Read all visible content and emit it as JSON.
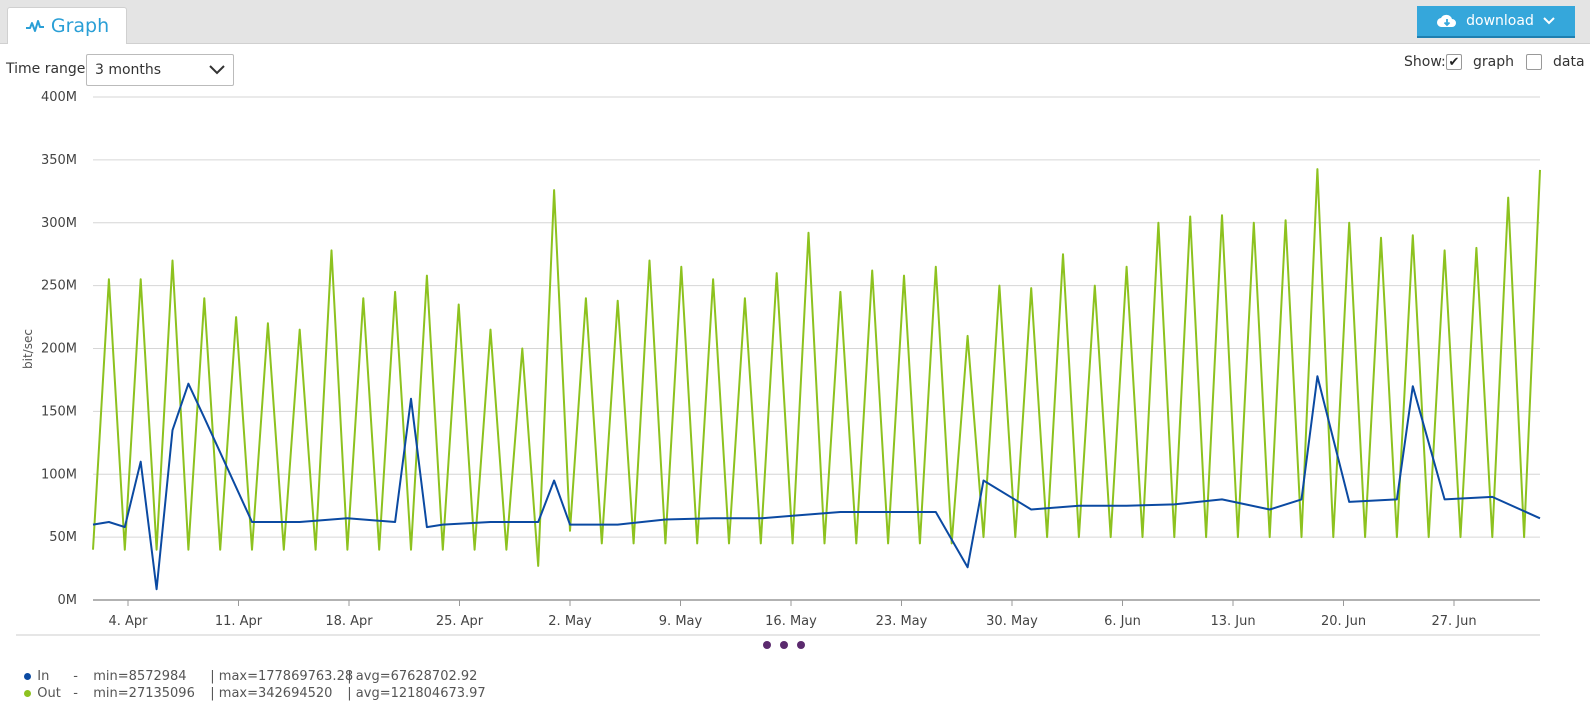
{
  "tab": {
    "label": "Graph",
    "icon": "activity-icon"
  },
  "download": {
    "label": "download",
    "icon": "cloud-download-icon"
  },
  "controls": {
    "time_range_label": "Time range:",
    "time_range_value": "3 months",
    "show_label": "Show:",
    "graph_label": "graph",
    "graph_checked": true,
    "data_label": "data",
    "data_checked": false
  },
  "legend": [
    {
      "name": "In",
      "dash": "-",
      "min": "min=8572984",
      "max": "| max=177869763.28",
      "avg": "| avg=67628702.92",
      "color": "#0b4aa2"
    },
    {
      "name": "Out",
      "dash": "-",
      "min": "min=27135096",
      "max": "| max=342694520",
      "avg": "| avg=121804673.97",
      "color": "#8dc21f"
    }
  ],
  "chart_data": {
    "type": "line",
    "ylabel": "bit/sec",
    "ylim": [
      0,
      400000000
    ],
    "yticks": [
      "0M",
      "50M",
      "100M",
      "150M",
      "200M",
      "250M",
      "300M",
      "350M",
      "400M"
    ],
    "xlim": [
      "2021-04-02",
      "2021-07-02"
    ],
    "xticks": [
      "4. Apr",
      "11. Apr",
      "18. Apr",
      "25. Apr",
      "2. May",
      "9. May",
      "16. May",
      "23. May",
      "30. May",
      "6. Jun",
      "13. Jun",
      "20. Jun",
      "27. Jun"
    ],
    "grid": true,
    "series": [
      {
        "name": "In",
        "color": "#0b4aa2",
        "x": [
          "2021-04-02",
          "2021-04-03",
          "2021-04-04",
          "2021-04-05",
          "2021-04-06",
          "2021-04-07",
          "2021-04-08",
          "2021-04-09",
          "2021-04-12",
          "2021-04-15",
          "2021-04-18",
          "2021-04-21",
          "2021-04-22",
          "2021-04-23",
          "2021-04-24",
          "2021-04-27",
          "2021-04-30",
          "2021-05-01",
          "2021-05-02",
          "2021-05-05",
          "2021-05-08",
          "2021-05-11",
          "2021-05-14",
          "2021-05-16",
          "2021-05-19",
          "2021-05-22",
          "2021-05-25",
          "2021-05-27",
          "2021-05-28",
          "2021-05-31",
          "2021-06-03",
          "2021-06-06",
          "2021-06-09",
          "2021-06-12",
          "2021-06-15",
          "2021-06-17",
          "2021-06-18",
          "2021-06-20",
          "2021-06-23",
          "2021-06-24",
          "2021-06-26",
          "2021-06-29",
          "2021-07-02"
        ],
        "values": [
          60000000,
          62000000,
          58000000,
          110000000,
          8572984,
          135000000,
          172000000,
          145000000,
          62000000,
          62000000,
          65000000,
          62000000,
          160000000,
          58000000,
          60000000,
          62000000,
          62000000,
          95000000,
          60000000,
          60000000,
          64000000,
          65000000,
          65000000,
          67000000,
          70000000,
          70000000,
          70000000,
          26000000,
          95000000,
          72000000,
          75000000,
          75000000,
          76000000,
          80000000,
          72000000,
          80000000,
          177869763,
          78000000,
          80000000,
          170000000,
          80000000,
          82000000,
          65000000
        ]
      },
      {
        "name": "Out",
        "color": "#8dc21f",
        "x": [
          "2021-04-02",
          "2021-04-03",
          "2021-04-04",
          "2021-04-05",
          "2021-04-06",
          "2021-04-07",
          "2021-04-08",
          "2021-04-09",
          "2021-04-10",
          "2021-04-11",
          "2021-04-12",
          "2021-04-13",
          "2021-04-14",
          "2021-04-15",
          "2021-04-16",
          "2021-04-17",
          "2021-04-18",
          "2021-04-19",
          "2021-04-20",
          "2021-04-21",
          "2021-04-22",
          "2021-04-23",
          "2021-04-24",
          "2021-04-25",
          "2021-04-26",
          "2021-04-27",
          "2021-04-28",
          "2021-04-29",
          "2021-04-30",
          "2021-05-01",
          "2021-05-02",
          "2021-05-03",
          "2021-05-04",
          "2021-05-05",
          "2021-05-06",
          "2021-05-07",
          "2021-05-08",
          "2021-05-09",
          "2021-05-10",
          "2021-05-11",
          "2021-05-12",
          "2021-05-13",
          "2021-05-14",
          "2021-05-15",
          "2021-05-16",
          "2021-05-17",
          "2021-05-18",
          "2021-05-19",
          "2021-05-20",
          "2021-05-21",
          "2021-05-22",
          "2021-05-23",
          "2021-05-24",
          "2021-05-25",
          "2021-05-26",
          "2021-05-27",
          "2021-05-28",
          "2021-05-29",
          "2021-05-30",
          "2021-05-31",
          "2021-06-01",
          "2021-06-02",
          "2021-06-03",
          "2021-06-04",
          "2021-06-05",
          "2021-06-06",
          "2021-06-07",
          "2021-06-08",
          "2021-06-09",
          "2021-06-10",
          "2021-06-11",
          "2021-06-12",
          "2021-06-13",
          "2021-06-14",
          "2021-06-15",
          "2021-06-16",
          "2021-06-17",
          "2021-06-18",
          "2021-06-19",
          "2021-06-20",
          "2021-06-21",
          "2021-06-22",
          "2021-06-23",
          "2021-06-24",
          "2021-06-25",
          "2021-06-26",
          "2021-06-27",
          "2021-06-28",
          "2021-06-29",
          "2021-06-30",
          "2021-07-01",
          "2021-07-02"
        ],
        "values": [
          40000000,
          255000000,
          40000000,
          255000000,
          40000000,
          270000000,
          40000000,
          240000000,
          40000000,
          225000000,
          40000000,
          220000000,
          40000000,
          215000000,
          40000000,
          278000000,
          40000000,
          240000000,
          40000000,
          245000000,
          40000000,
          258000000,
          40000000,
          235000000,
          40000000,
          215000000,
          40000000,
          200000000,
          27135096,
          326000000,
          55000000,
          240000000,
          45000000,
          238000000,
          45000000,
          270000000,
          45000000,
          265000000,
          45000000,
          255000000,
          45000000,
          240000000,
          45000000,
          260000000,
          45000000,
          292000000,
          45000000,
          245000000,
          45000000,
          262000000,
          45000000,
          258000000,
          45000000,
          265000000,
          45000000,
          210000000,
          50000000,
          250000000,
          50000000,
          248000000,
          50000000,
          275000000,
          50000000,
          250000000,
          50000000,
          265000000,
          50000000,
          300000000,
          50000000,
          305000000,
          50000000,
          306000000,
          50000000,
          300000000,
          50000000,
          302000000,
          50000000,
          342694520,
          50000000,
          300000000,
          50000000,
          288000000,
          50000000,
          290000000,
          50000000,
          278000000,
          50000000,
          280000000,
          50000000,
          320000000,
          50000000,
          342000000
        ]
      }
    ]
  }
}
